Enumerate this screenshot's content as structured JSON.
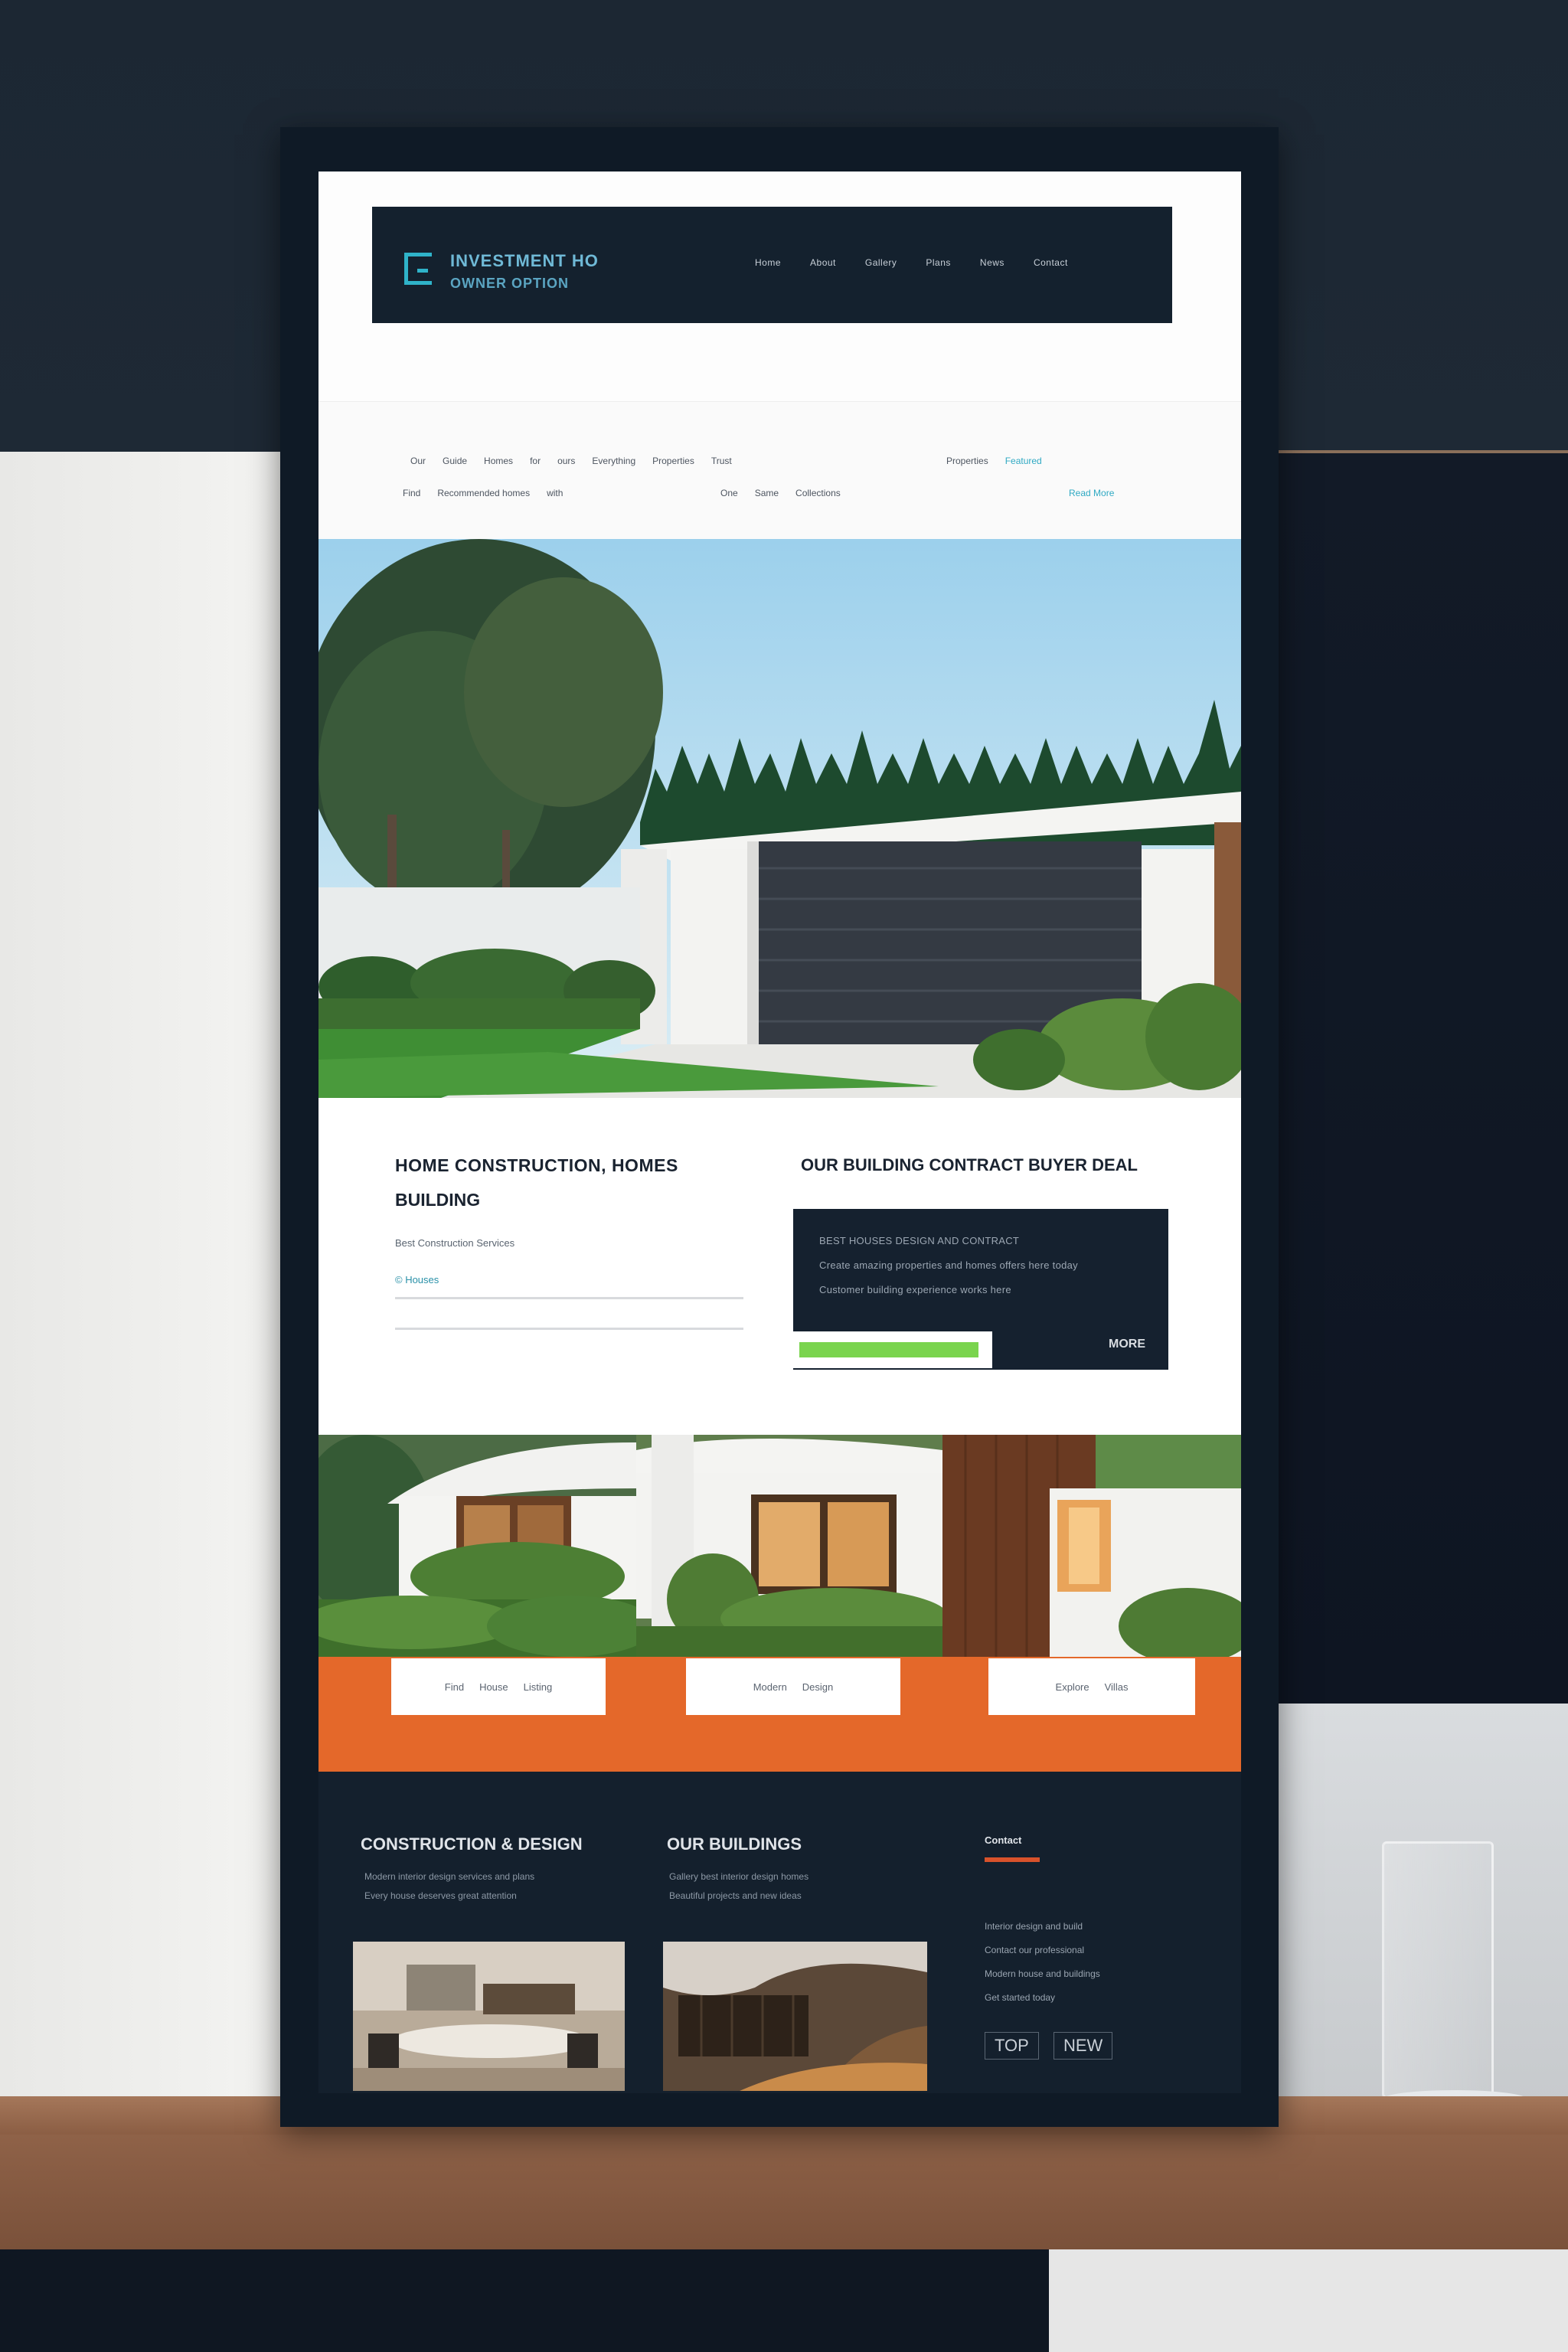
{
  "header": {
    "brand_line1": "INVESTMENT HO",
    "brand_line2": "OWNER OPTION",
    "nav": [
      "Home",
      "About",
      "Gallery",
      "Plans",
      "News",
      "Contact"
    ]
  },
  "strip": {
    "row1_left": [
      "Our",
      "Guide",
      "Homes",
      "for",
      "ours",
      "Everything",
      "Properties",
      "Trust"
    ],
    "row1_right": "Properties",
    "row1_link": "Featured",
    "row2_left": [
      "Find",
      "Recommended homes",
      "with"
    ],
    "row2_mid": [
      "One",
      "Same",
      "Collections"
    ],
    "row2_link": "Read More"
  },
  "content": {
    "title_line1": "HOME CONSTRUCTION, HOMES",
    "title_line2": "BUILDING",
    "subtitle": "Best Construction Services",
    "meta": "© Houses",
    "promo_title": "OUR BUILDING CONTRACT BUYER DEAL",
    "promo_lines": [
      "BEST HOUSES  DESIGN AND CONTRACT",
      "Create amazing properties and homes offers here today",
      "Customer building experience works here"
    ],
    "promo_button": "MORE"
  },
  "cards": [
    {
      "label_a": "Find",
      "label_b": "House",
      "label_c": "Listing"
    },
    {
      "label_a": "Modern",
      "label_b": "Design"
    },
    {
      "label_a": "Explore",
      "label_b": "Villas"
    }
  ],
  "footer": {
    "col1_title": "CONSTRUCTION & DESIGN",
    "col1_sub1": "Modern interior design services and plans",
    "col1_sub2": "Every house deserves great attention",
    "col2_title": "OUR BUILDINGS",
    "col2_sub1": "Gallery best interior design homes",
    "col2_sub2": "Beautiful projects and new ideas",
    "col3_head": "Contact",
    "col3_lines": [
      "Interior design and build",
      "Contact our professional",
      "Modern house and buildings",
      "Get started today"
    ],
    "btn_left": "TOP",
    "btn_right": "NEW"
  },
  "colors": {
    "nav_bg": "#14212e",
    "accent_cyan": "#2fb3c9",
    "accent_orange": "#e4682a",
    "accent_green": "#7ad44e",
    "footer_accent": "#d8522b"
  }
}
